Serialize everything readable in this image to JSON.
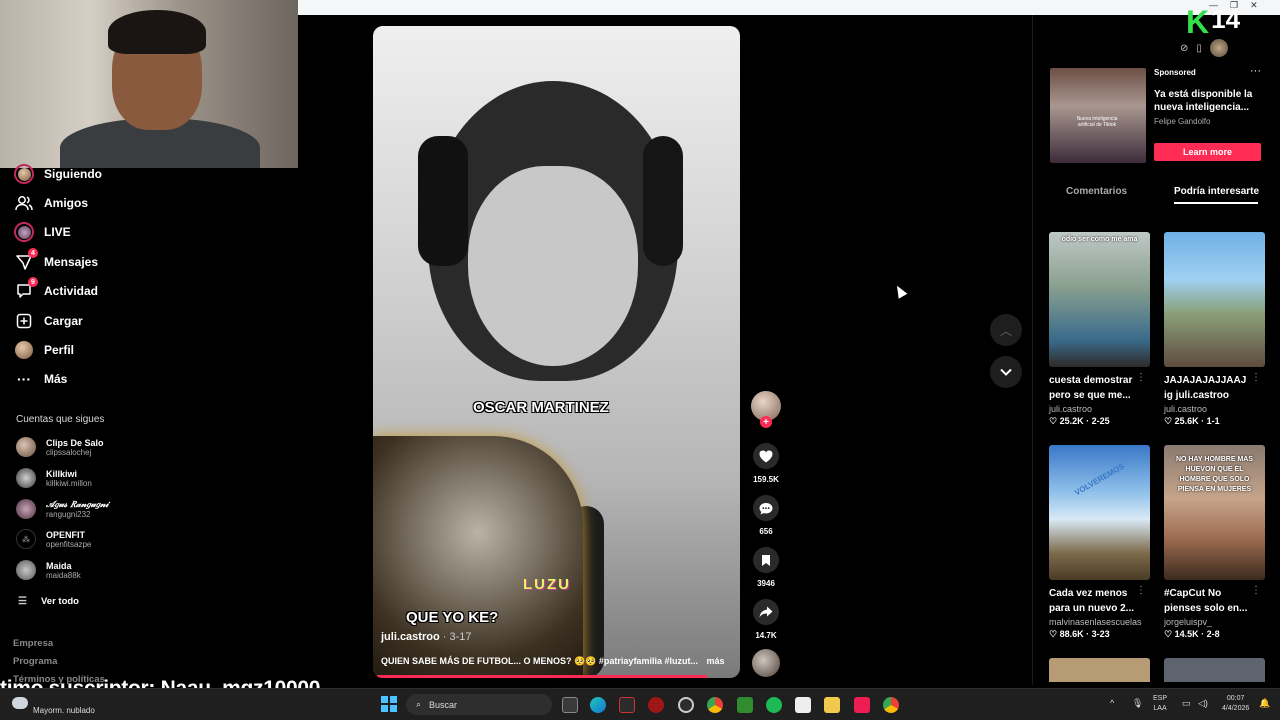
{
  "sidebar": {
    "nav": [
      {
        "label": "Siguiendo",
        "icon": "following-avatar-icon"
      },
      {
        "label": "Amigos",
        "icon": "friends-icon"
      },
      {
        "label": "LIVE",
        "icon": "live-icon"
      },
      {
        "label": "Mensajes",
        "icon": "messages-icon",
        "badge": "4"
      },
      {
        "label": "Actividad",
        "icon": "activity-icon",
        "badge": "9"
      },
      {
        "label": "Cargar",
        "icon": "upload-icon"
      },
      {
        "label": "Perfil",
        "icon": "profile-avatar-icon"
      },
      {
        "label": "Más",
        "icon": "more-icon"
      }
    ],
    "following_title": "Cuentas que sigues",
    "following": [
      {
        "name": "Clips De Salo",
        "handle": "clipssalochej"
      },
      {
        "name": "Killkiwi",
        "handle": "killkiwi.millon"
      },
      {
        "name": "𝒜𝑔𝓊𝓈 𝑅𝒶𝓃𝑔𝓊𝑔𝓃𝒾",
        "handle": "rangugni232"
      },
      {
        "name": "OPENFIT",
        "handle": "openfitsazpe"
      },
      {
        "name": "Maida",
        "handle": "maida88k"
      }
    ],
    "see_all": "Ver todo",
    "footer": [
      "Empresa",
      "Programa",
      "Términos y políticas"
    ]
  },
  "stream_overlay": {
    "subscriber_text": "timo suscriptor: Naau_mqz10000"
  },
  "video": {
    "overlay_top": "OSCAR MARTINEZ",
    "overlay_bottom": "QUE YO KE?",
    "watermark": "LUZU",
    "author": "juli.castroo",
    "date": " · 3-17",
    "caption": "QUIEN SABE MÁS DE FUTBOL... O MENOS? 🥺🥺 #patriayfamilia #luzut...",
    "more": "más",
    "progress": 0.9
  },
  "actions": {
    "likes": "159.5K",
    "comments": "656",
    "saves": "3946",
    "shares": "14.7K"
  },
  "right_panel": {
    "ad": {
      "sponsored": "Sponsored",
      "title": "Ya está disponible la nueva inteligencia...",
      "author": "Felipe Gandolfo",
      "cta": "Learn more",
      "thumb_text": "Nueva inteligencia artificial de Tiktok"
    },
    "tabs": [
      "Comentarios",
      "Podría interesarte"
    ],
    "cards": [
      {
        "title": "cuesta demostrar pero se que me...",
        "handle": "juli.castroo",
        "likes": "25.2K",
        "date": "2-25",
        "thumb_text": "odio ser como me ama"
      },
      {
        "title": "JAJAJAJAJJAAJ ig juli.castroo",
        "handle": "juli.castroo",
        "likes": "25.6K",
        "date": "1-1",
        "thumb_text": ""
      },
      {
        "title": "Cada vez menos para un nuevo 2...",
        "handle": "malvinasenlasescuelas",
        "likes": "88.6K",
        "date": "3-23",
        "thumb_text": "VOLVEREMOS"
      },
      {
        "title": "#CapCut No pienses solo en...",
        "handle": "jorgeluispv_",
        "likes": "14.5K",
        "date": "2-8",
        "thumb_text": "NO HAY HOMBRE MAS HUEVON QUE EL HOMBRE QUE SOLO PIENSA EN MUJERES"
      }
    ]
  },
  "brand": {
    "logo_k": "K",
    "logo_num": "14"
  },
  "taskbar": {
    "weather": "Mayorm. nublado",
    "search": "Buscar",
    "lang": "ESP",
    "lang2": "LAA",
    "time": "00:07",
    "date": "4/4/2026"
  },
  "colors": {
    "accent": "#fe2c55",
    "live_ring": "#c02a5a",
    "logo_green": "#32e04a"
  }
}
